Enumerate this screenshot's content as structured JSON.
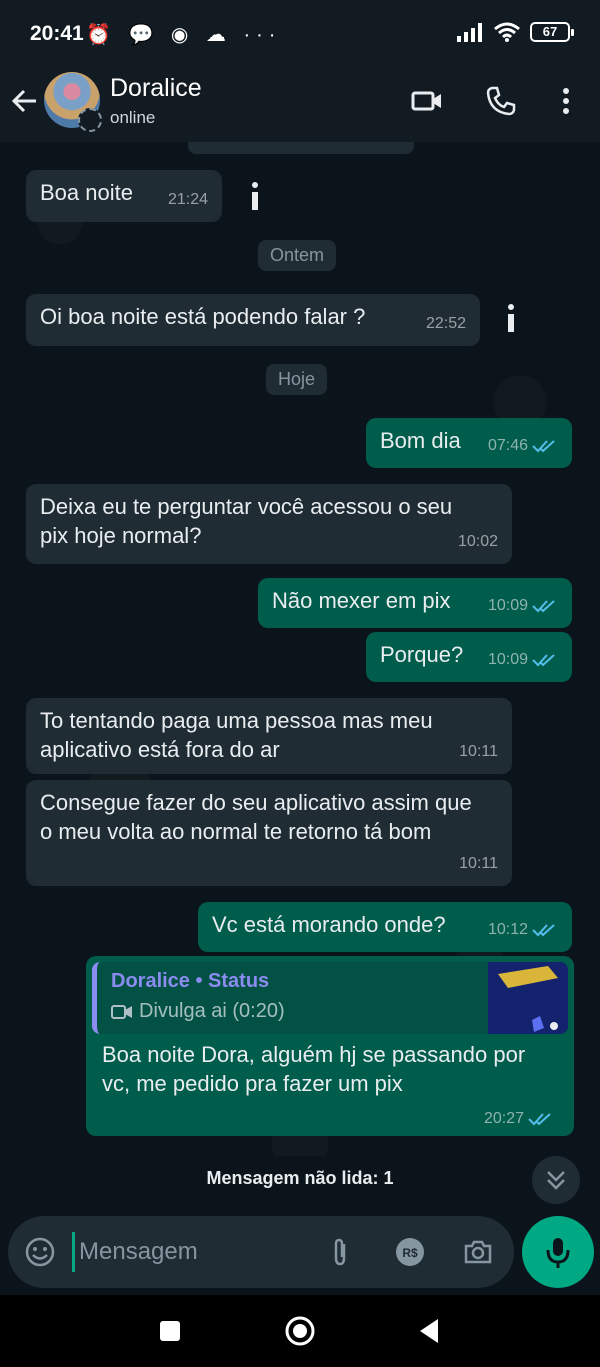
{
  "status_bar": {
    "time": "20:41",
    "left_icons": "⏰ 💬 ◉ ☁ ···",
    "battery": "67"
  },
  "header": {
    "name": "Doralice",
    "status": "online"
  },
  "messages": [
    {
      "text": "Boa noite",
      "time": "21:24"
    },
    {
      "text": "Oi boa noite está podendo falar ?",
      "time": "22:52"
    },
    {
      "text": "Bom dia",
      "time": "07:46"
    },
    {
      "text": "Deixa eu te perguntar você acessou o seu pix hoje normal?",
      "time": "10:02"
    },
    {
      "text": "Não mexer em pix",
      "time": "10:09"
    },
    {
      "text": "Porque?",
      "time": "10:09"
    },
    {
      "text": "To tentando paga uma pessoa mas meu aplicativo está fora do ar",
      "time": "10:11"
    },
    {
      "text": "Consegue fazer do seu aplicativo assim que o meu volta ao normal te retorno tá bom",
      "time": "10:11"
    },
    {
      "text": "Vc está morando onde?",
      "time": "10:12"
    },
    {
      "text": "Boa noite Dora, alguém hj se passando por vc, me pedido pra fazer um pix",
      "time": "20:27"
    }
  ],
  "date_chips": {
    "yesterday": "Ontem",
    "today": "Hoje"
  },
  "quote": {
    "author": "Doralice • Status",
    "subtitle": "Divulga ai (0:20)"
  },
  "unread_banner": "Mensagem não lida: 1",
  "input": {
    "placeholder": "Mensagem"
  },
  "colors": {
    "incoming": "#1f2c34",
    "outgoing": "#005c4b",
    "accent": "#00a884",
    "read_ticks": "#53bdeb"
  }
}
